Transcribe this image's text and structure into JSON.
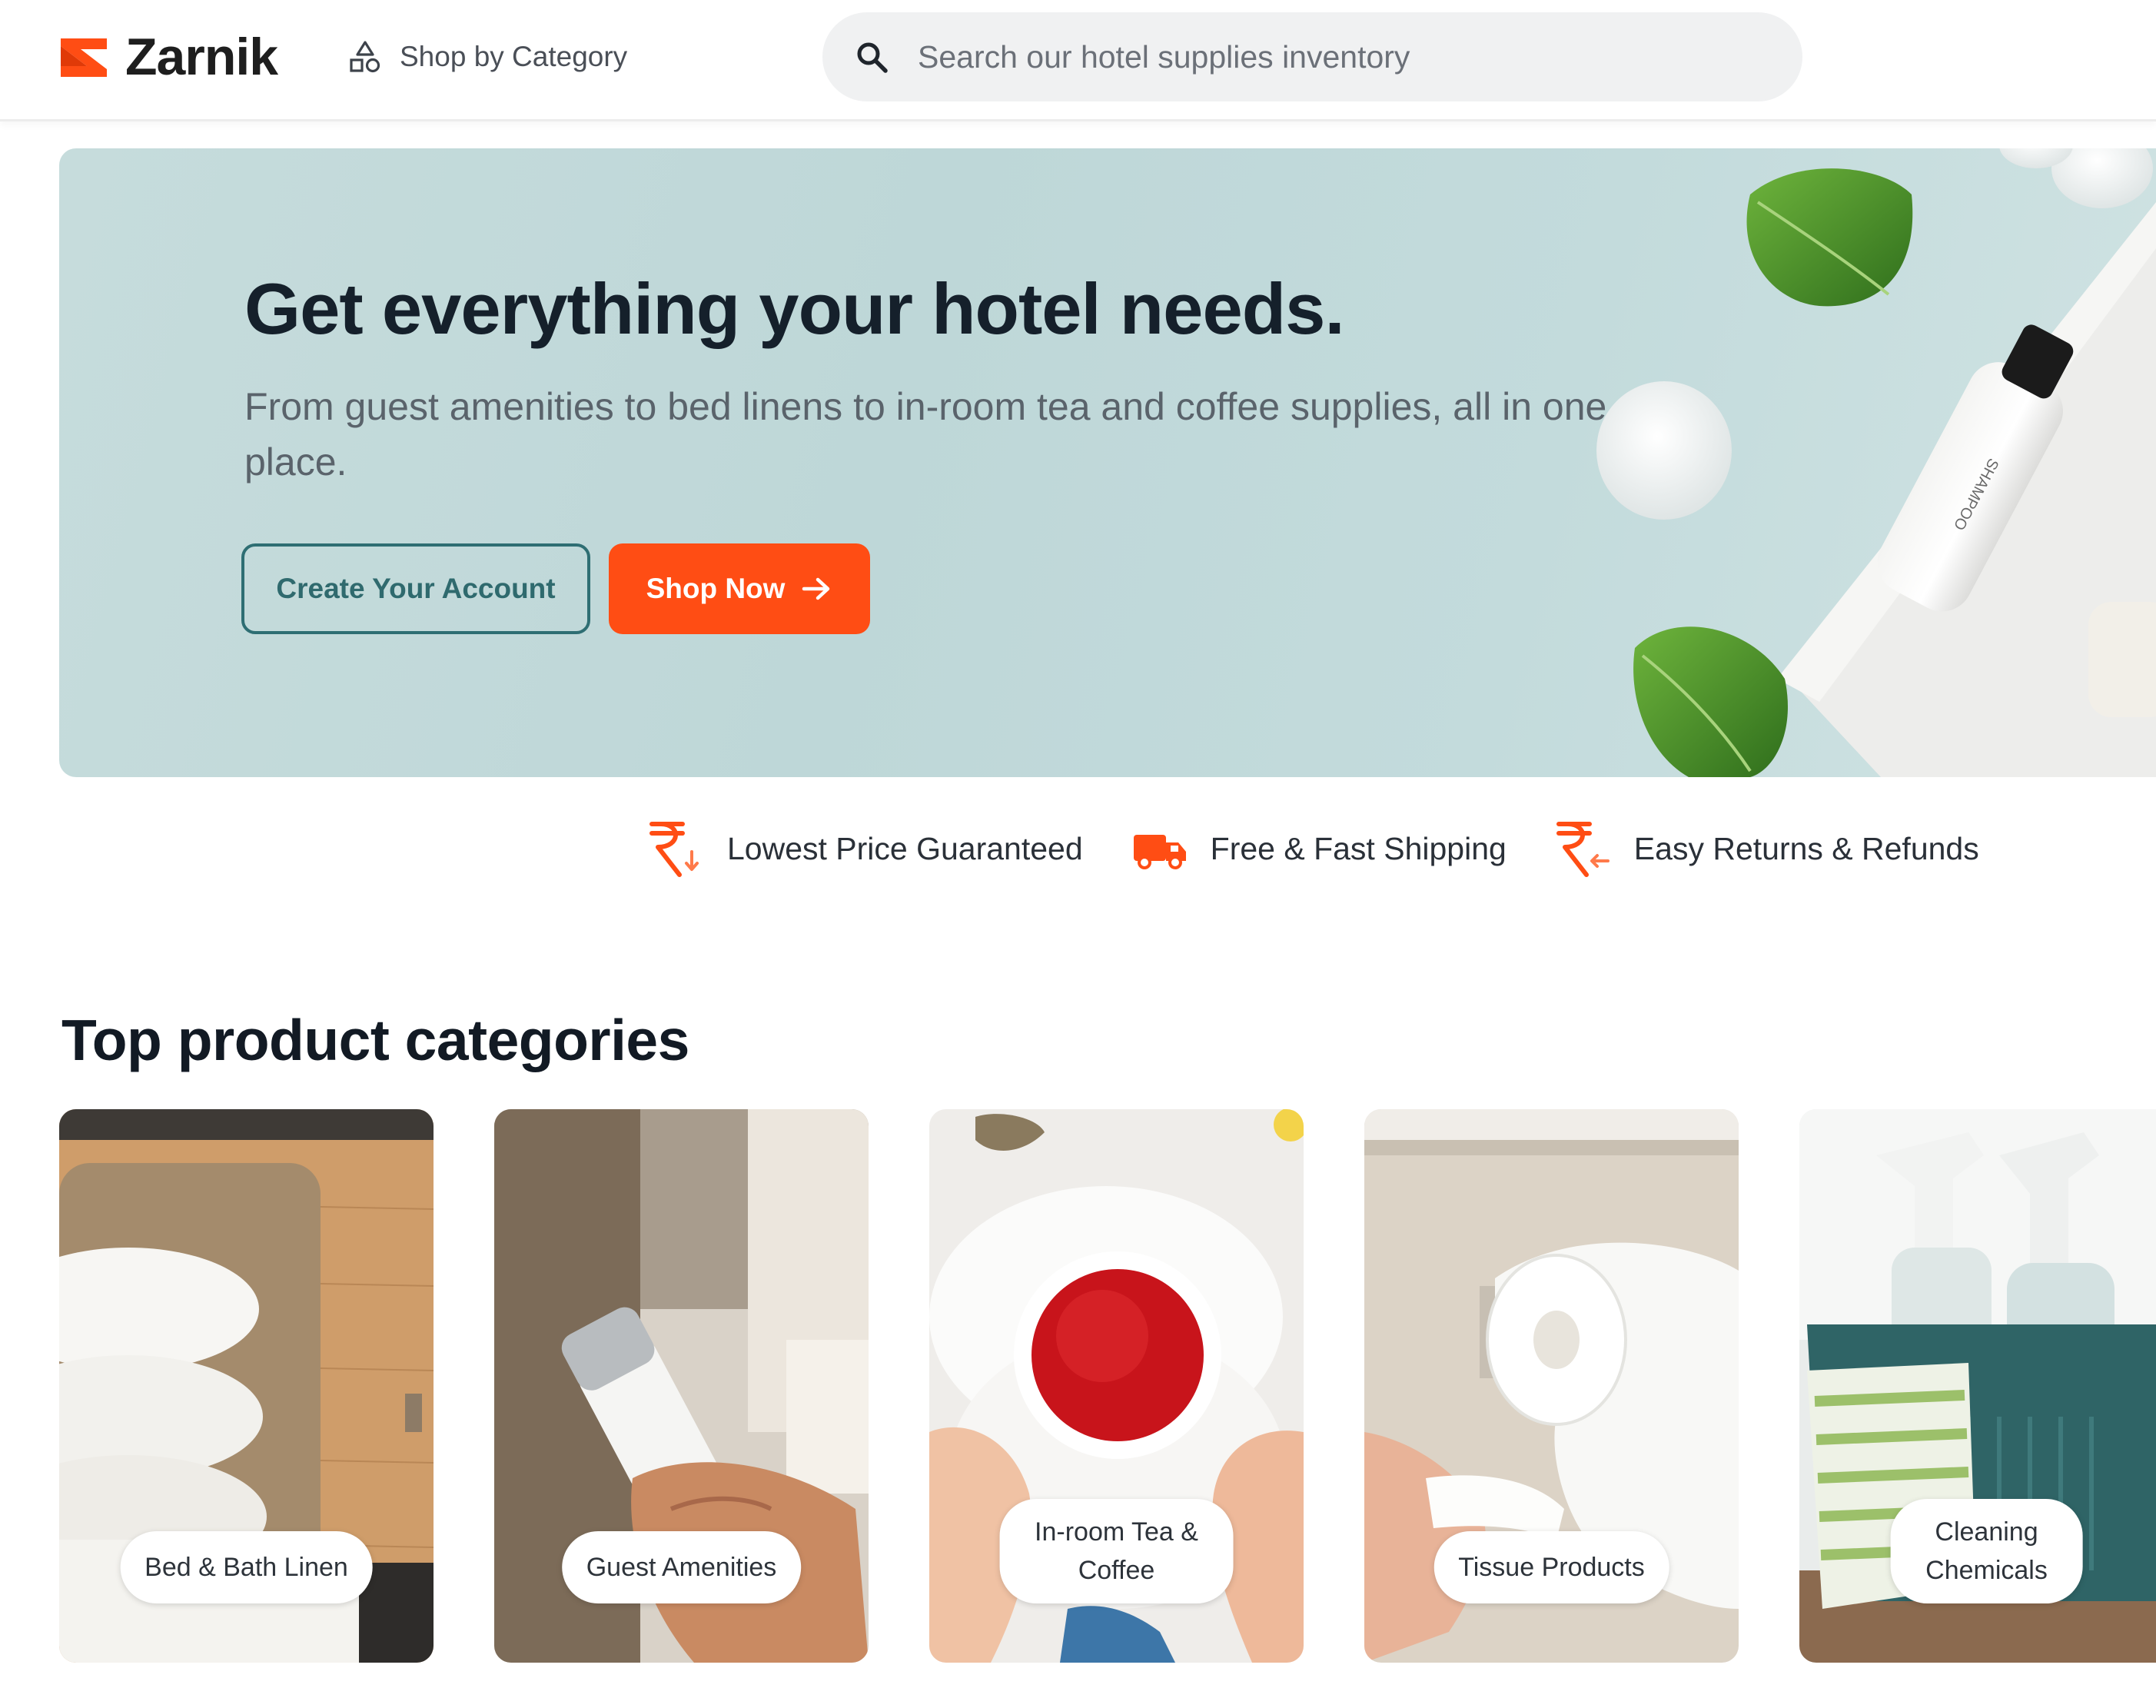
{
  "brand": {
    "name": "Zarnik",
    "accent_color": "#ff4d14",
    "logo_icon": "zarnik-logo-icon"
  },
  "header": {
    "shop_by_category_label": "Shop by Category",
    "shop_by_category_icon": "shapes-icon",
    "search_icon": "search-icon",
    "search_placeholder": "Search our hotel supplies inventory"
  },
  "hero": {
    "title": "Get everything your hotel needs.",
    "subtitle": "From guest amenities to bed linens to in-room tea and coffee supplies, all in one place.",
    "secondary_button": "Create Your Account",
    "primary_button": "Shop Now",
    "primary_button_icon": "arrow-right-icon",
    "background_color": "#c3dadb"
  },
  "features": [
    {
      "label": "Lowest Price Guaranteed",
      "icon": "rupee-down-icon"
    },
    {
      "label": "Free & Fast Shipping",
      "icon": "truck-icon"
    },
    {
      "label": "Easy Returns & Refunds",
      "icon": "rupee-return-icon"
    }
  ],
  "categories": {
    "title": "Top product categories",
    "items": [
      {
        "label": "Bed & Bath Linen"
      },
      {
        "label": "Guest Amenities"
      },
      {
        "label": "In-room Tea &\nCoffee"
      },
      {
        "label": "Tissue Products"
      },
      {
        "label": "Cleaning\nChemicals"
      }
    ]
  }
}
